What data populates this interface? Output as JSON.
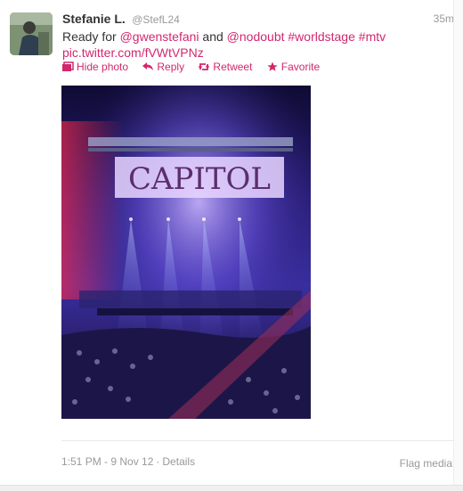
{
  "tweet": {
    "fullname": "Stefanie L.",
    "username": "@StefL24",
    "time": "35m",
    "text": {
      "prefix": "Ready for ",
      "mention1": "@gwenstefani",
      "and": " and ",
      "mention2": "@nodoubt",
      "hashtag1": "#worldstage",
      "hashtag2": "#mtv",
      "pic_link": "pic.twitter.com/fVWtVPNz"
    },
    "actions": {
      "hide_photo": "Hide photo",
      "reply": "Reply",
      "retweet": "Retweet",
      "favorite": "Favorite"
    },
    "photo": {
      "sign_text": "CAPITOL"
    },
    "footer": {
      "timestamp": "1:51 PM - 9 Nov 12",
      "separator": "·",
      "details": "Details",
      "flag_media": "Flag media"
    }
  },
  "colors": {
    "link": "#d1286e",
    "muted": "#999999",
    "text": "#333333"
  },
  "icons": [
    "photo-icon",
    "reply-icon",
    "retweet-icon",
    "star-icon"
  ]
}
